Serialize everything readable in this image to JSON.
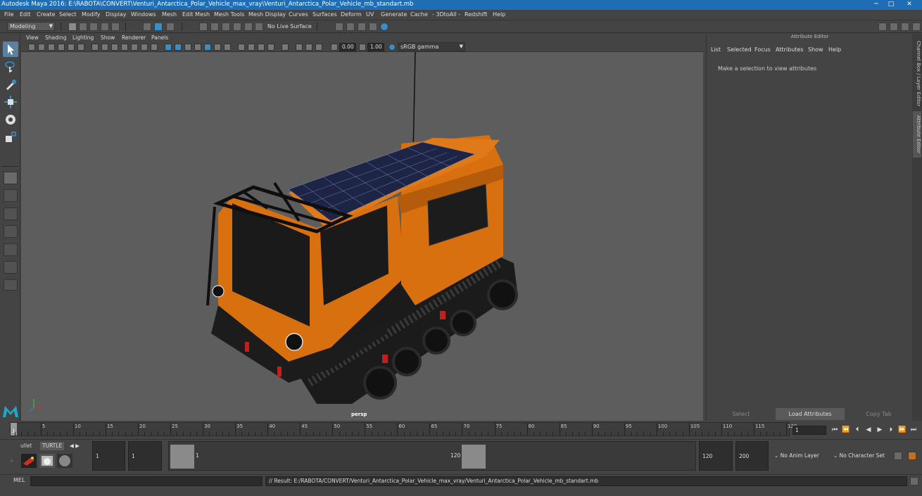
{
  "window": {
    "title": "Autodesk Maya 2016: E:\\RABOTA\\CONVERT\\Venturi_Antarctica_Polar_Vehicle_max_vray\\Venturi_Antarctica_Polar_Vehicle_mb_standart.mb"
  },
  "menubar": {
    "items": [
      "File",
      "Edit",
      "Create",
      "Select",
      "Modify",
      "Display",
      "Windows",
      "Mesh",
      "Edit Mesh",
      "Mesh Tools",
      "Mesh Display",
      "Curves",
      "Surfaces",
      "Deform",
      "UV",
      "Generate",
      "Cache",
      "- 3DtoAll -",
      "Redshift",
      "Help"
    ]
  },
  "statusline": {
    "mode": "Modeling",
    "live_surface": "No Live Surface"
  },
  "viewport": {
    "menu": [
      "View",
      "Shading",
      "Lighting",
      "Show",
      "Renderer",
      "Panels"
    ],
    "gamma_in": "0.00",
    "gamma_out": "1.00",
    "color_space": "sRGB gamma",
    "camera_label": "persp"
  },
  "attribute_editor": {
    "header": "Attribute Editor",
    "menu": [
      "List",
      "Selected",
      "Focus",
      "Attributes",
      "Show",
      "Help"
    ],
    "message": "Make a selection to view attributes",
    "buttons": [
      "Select",
      "Load Attributes",
      "Copy Tab"
    ],
    "side_tabs": [
      "Channel Box / Layer Editor",
      "Attribute Editor"
    ]
  },
  "timeslider": {
    "ticks": [
      "1",
      "5",
      "10",
      "15",
      "20",
      "25",
      "30",
      "35",
      "40",
      "45",
      "50",
      "55",
      "60",
      "65",
      "70",
      "75",
      "80",
      "85",
      "90",
      "95",
      "100",
      "105",
      "110",
      "115",
      "120"
    ],
    "current_frame": "1"
  },
  "range": {
    "shelf_tabs": [
      "ullet",
      "TURTLE"
    ],
    "start": "1",
    "playback_start": "1",
    "handle_start": "1",
    "handle_end": "120",
    "playback_end": "120",
    "end": "200",
    "anim_layer": "No Anim Layer",
    "character_set": "No Character Set"
  },
  "commandline": {
    "label": "MEL",
    "result": "// Result: E:/RABOTA/CONVERT/Venturi_Antarctica_Polar_Vehicle_max_vray/Venturi_Antarctica_Polar_Vehicle_mb_standart.mb"
  },
  "colors": {
    "title_bar": "#1f6db5",
    "ui_bg": "#444444",
    "viewport_bg": "#5d5d5d",
    "vehicle_body": "#d9700f",
    "accent": "#3a8ec8"
  }
}
